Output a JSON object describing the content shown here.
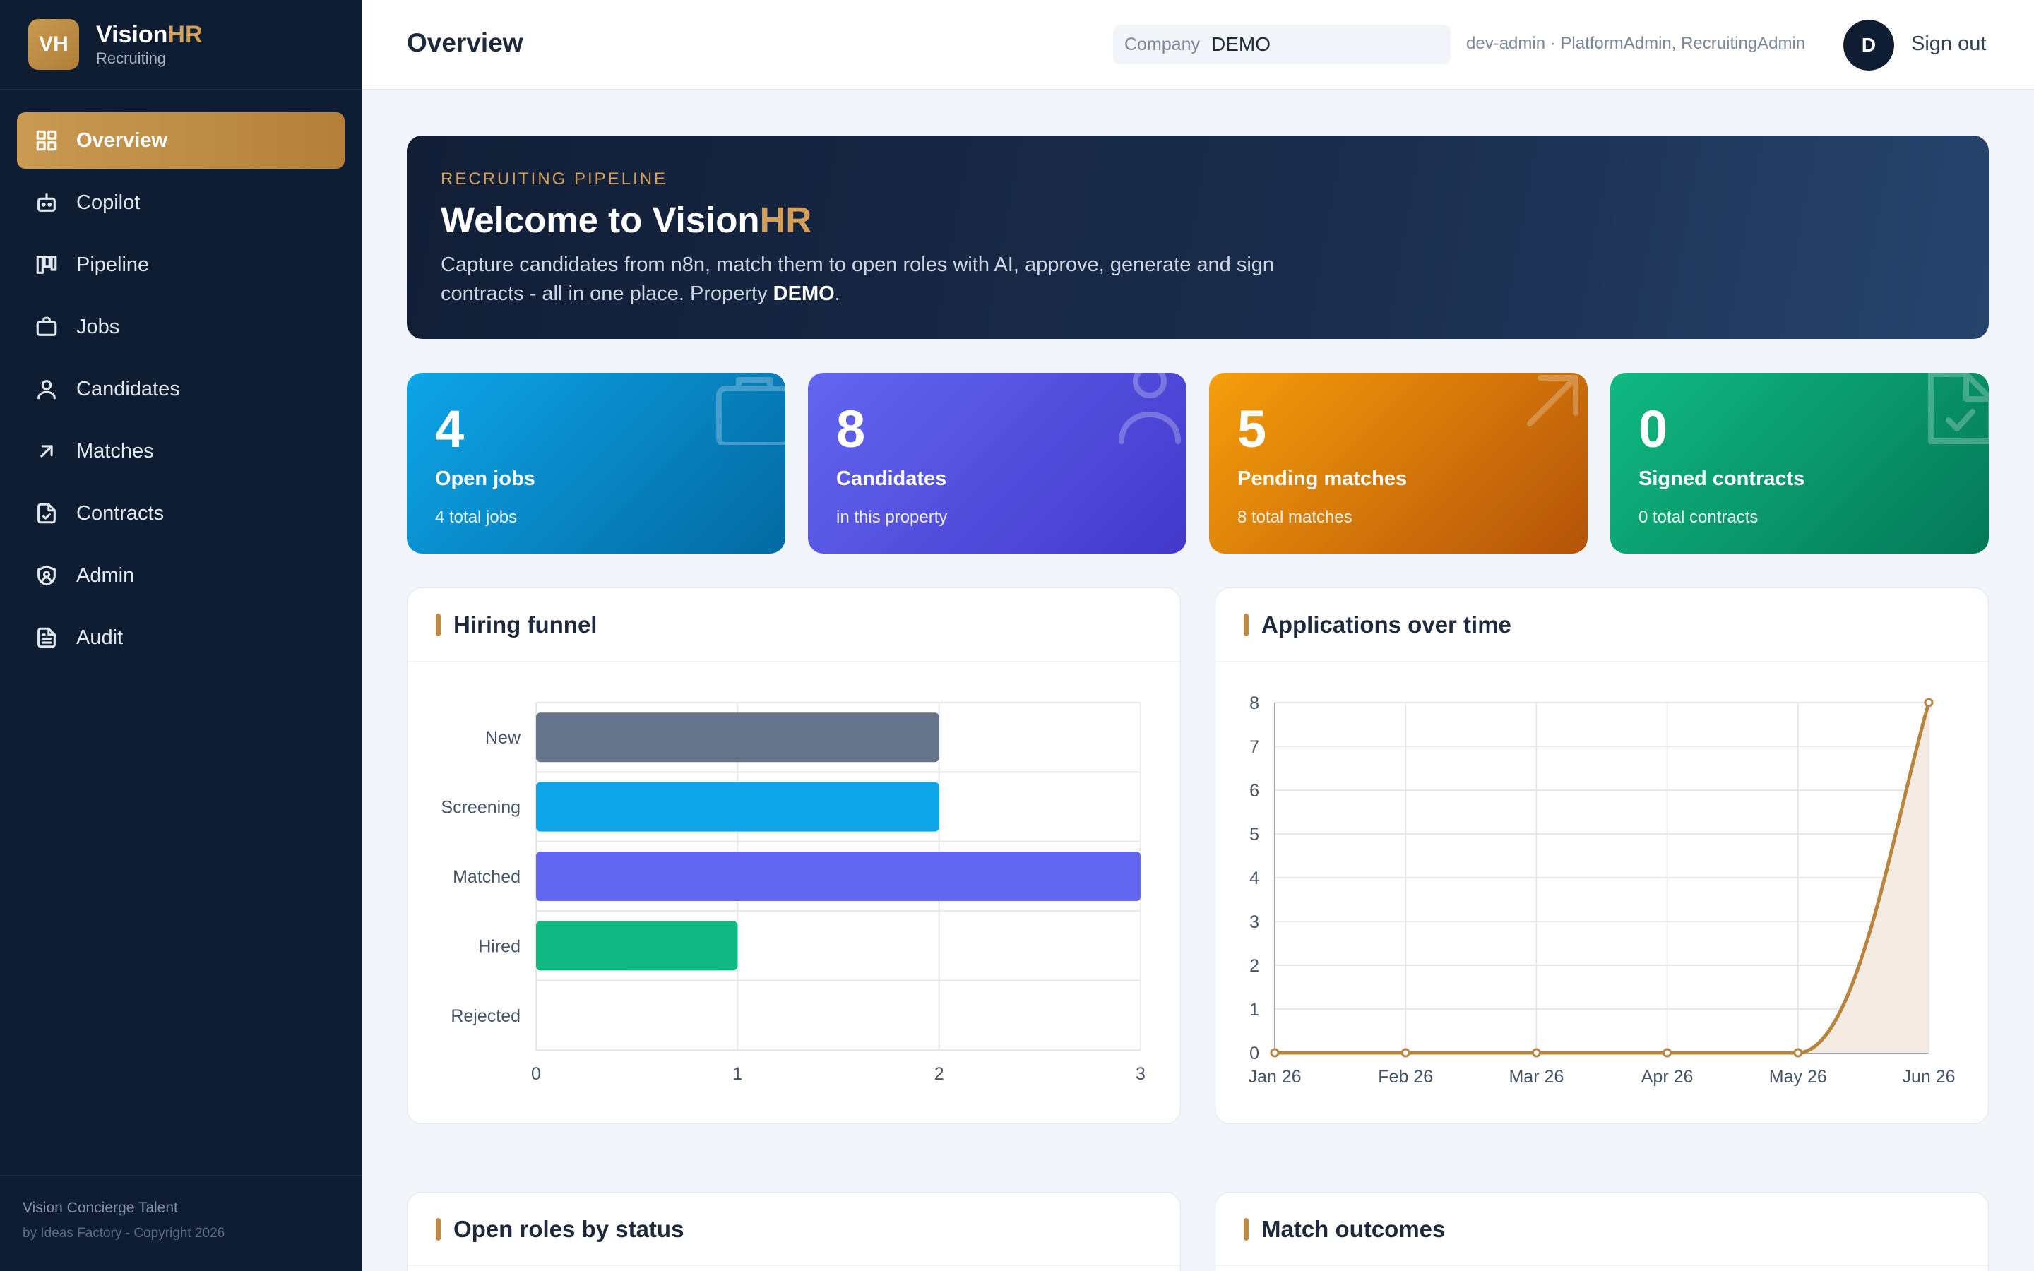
{
  "sidebar": {
    "logo_text": "VH",
    "brand_name_main": "Vision",
    "brand_name_accent": "HR",
    "brand_sub": "Recruiting",
    "items": [
      {
        "label": "Overview",
        "icon": "grid-icon",
        "active": true
      },
      {
        "label": "Copilot",
        "icon": "bot-icon"
      },
      {
        "label": "Pipeline",
        "icon": "kanban-icon"
      },
      {
        "label": "Jobs",
        "icon": "briefcase-icon"
      },
      {
        "label": "Candidates",
        "icon": "user-icon"
      },
      {
        "label": "Matches",
        "icon": "arrow-up-right-icon"
      },
      {
        "label": "Contracts",
        "icon": "file-check-icon"
      },
      {
        "label": "Admin",
        "icon": "shield-user-icon"
      },
      {
        "label": "Audit",
        "icon": "file-text-icon"
      }
    ],
    "footer_line1": "Vision Concierge Talent",
    "footer_line2": "by Ideas Factory - Copyright 2026"
  },
  "header": {
    "title": "Overview",
    "company_label": "Company",
    "company_value": "DEMO",
    "user_info": "dev-admin · PlatformAdmin, RecruitingAdmin",
    "avatar_initial": "D",
    "signout_label": "Sign out"
  },
  "hero": {
    "kicker": "RECRUITING PIPELINE",
    "title_main": "Welcome to Vision",
    "title_accent": "HR",
    "desc_text": "Capture candidates from n8n, match them to open roles with AI, approve, generate and sign contracts - all in one place. Property ",
    "desc_property": "DEMO",
    "desc_end": "."
  },
  "stats": [
    {
      "value": "4",
      "title": "Open jobs",
      "sub": "4 total jobs",
      "icon": "briefcase-icon",
      "color_from": "#0ea5e9",
      "color_to": "#0369a1"
    },
    {
      "value": "8",
      "title": "Candidates",
      "sub": "in this property",
      "icon": "user-icon",
      "color_from": "#6366f1",
      "color_to": "#4338ca"
    },
    {
      "value": "5",
      "title": "Pending matches",
      "sub": "8 total matches",
      "icon": "arrow-up-right-icon",
      "color_from": "#f59e0b",
      "color_to": "#b45309"
    },
    {
      "value": "0",
      "title": "Signed contracts",
      "sub": "0 total contracts",
      "icon": "file-check-icon",
      "color_from": "#10b981",
      "color_to": "#047857"
    }
  ],
  "panels": {
    "funnel_title": "Hiring funnel",
    "applications_title": "Applications over time",
    "roles_title": "Open roles by status",
    "outcomes_title": "Match outcomes"
  },
  "chart_data": [
    {
      "type": "bar",
      "orientation": "horizontal",
      "title": "Hiring funnel",
      "categories": [
        "New",
        "Screening",
        "Matched",
        "Hired",
        "Rejected"
      ],
      "values": [
        2,
        2,
        3,
        1,
        0
      ],
      "colors": [
        "#64748b",
        "#0ea5e9",
        "#6366f1",
        "#10b981",
        "#ef4444"
      ],
      "xlim": [
        0,
        3
      ],
      "xticks": [
        "0",
        "1",
        "2",
        "3"
      ],
      "grid": true
    },
    {
      "type": "area",
      "title": "Applications over time",
      "x": [
        "Jan 26",
        "Feb 26",
        "Mar 26",
        "Apr 26",
        "May 26",
        "Jun 26"
      ],
      "values": [
        0,
        0,
        0,
        0,
        0,
        8
      ],
      "ylim": [
        0,
        8
      ],
      "yticks": [
        "0",
        "1",
        "2",
        "3",
        "4",
        "5",
        "6",
        "7",
        "8"
      ],
      "line_color": "#b8843e",
      "fill_color": "#f3ebe1",
      "grid": true
    }
  ]
}
